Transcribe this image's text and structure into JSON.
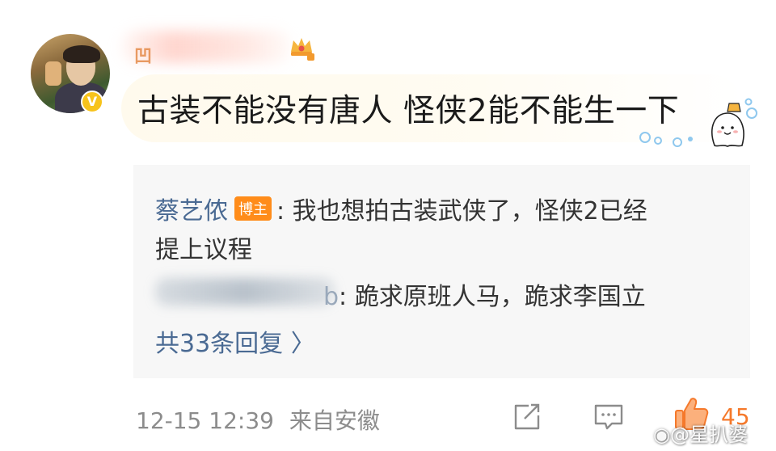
{
  "comment": {
    "username_visible_prefix": "凹",
    "text": "古装不能没有唐人 怪侠2能不能生一下",
    "verified_badge_symbol": "V"
  },
  "replies": [
    {
      "name": "蔡艺侬",
      "tag": "博主",
      "text_line1": ": 我也想拍古装武侠了，怪侠2已经",
      "text_line2": "提上议程"
    },
    {
      "name_suffix": "b",
      "text": ": 跪求原班人马，跪求李国立"
    }
  ],
  "more_replies": "共33条回复 〉",
  "footer": {
    "time": "12-15 12:39",
    "source": "来自安徽",
    "like_count": "45"
  },
  "watermark": "@星扒婆",
  "colors": {
    "link": "#4a6a93",
    "accent": "#f5792b",
    "host_tag": "#ff8c1a",
    "muted": "#8c8c8c"
  }
}
